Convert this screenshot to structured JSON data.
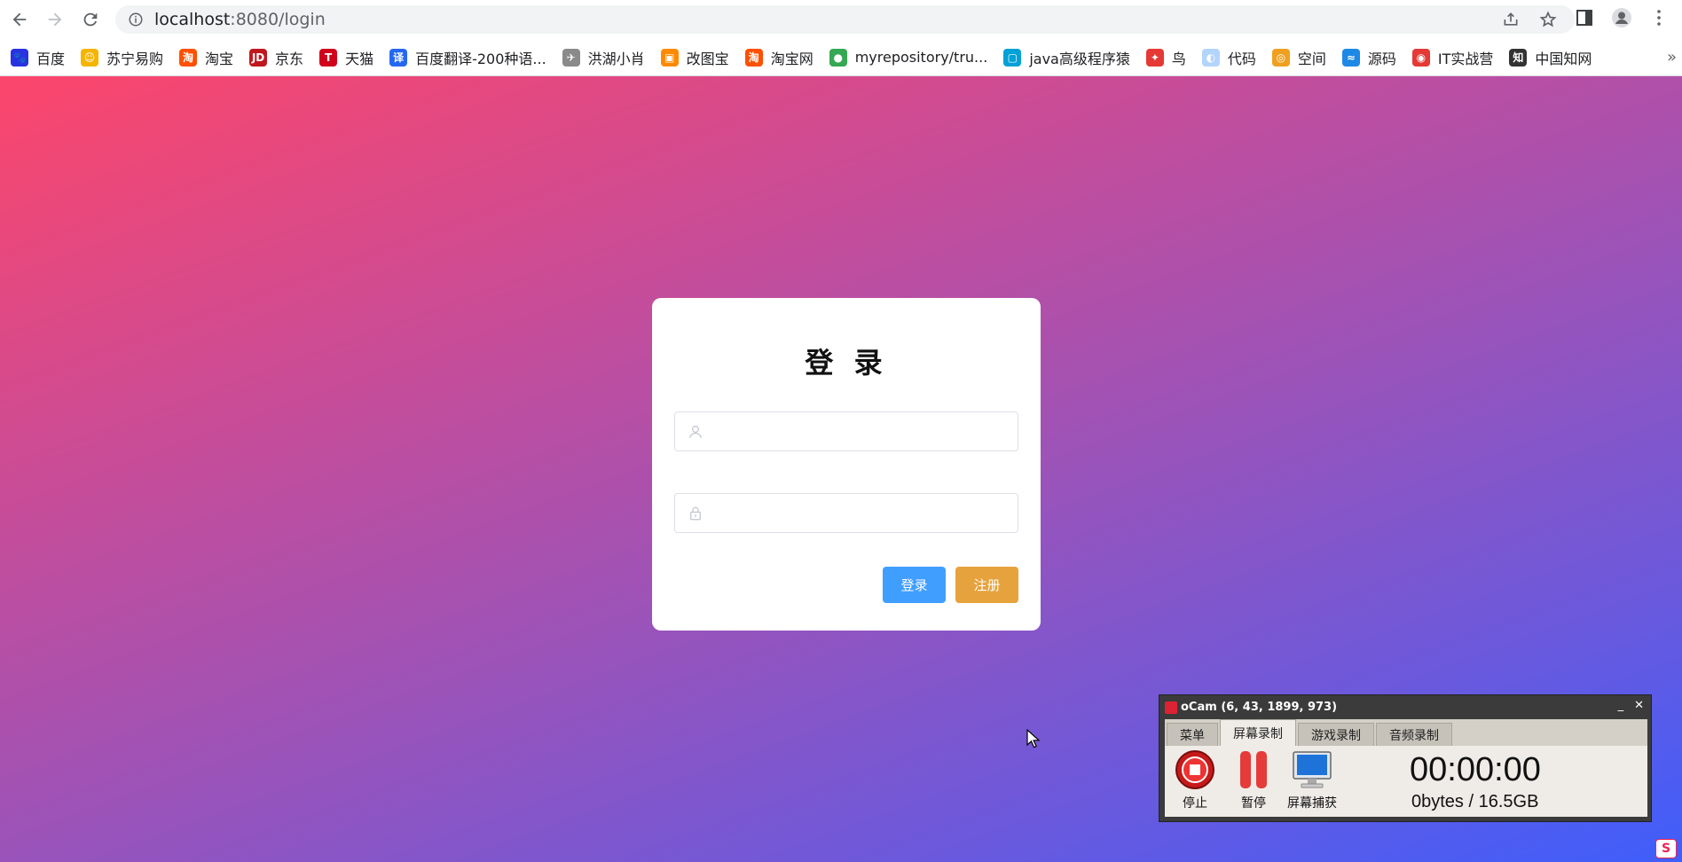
{
  "browser": {
    "url_host": "localhost",
    "url_path": ":8080/login"
  },
  "bookmarks": [
    {
      "label": "百度",
      "icon": "paw-icon",
      "color": "#2932e1",
      "glyph": "🐾"
    },
    {
      "label": "苏宁易购",
      "icon": "suning-icon",
      "color": "#f5b400",
      "glyph": "☺"
    },
    {
      "label": "淘宝",
      "icon": "taobao-icon",
      "color": "#ff5000",
      "glyph": "淘"
    },
    {
      "label": "京东",
      "icon": "jd-icon",
      "color": "#c0171e",
      "glyph": "JD"
    },
    {
      "label": "天猫",
      "icon": "tmall-icon",
      "color": "#d0021b",
      "glyph": "T"
    },
    {
      "label": "百度翻译-200种语...",
      "icon": "translate-icon",
      "color": "#2468f2",
      "glyph": "译"
    },
    {
      "label": "洪湖小肖",
      "icon": "bird-icon",
      "color": "#8a8a8a",
      "glyph": "✈"
    },
    {
      "label": "改图宝",
      "icon": "gaitubao-icon",
      "color": "#ff8a00",
      "glyph": "▣"
    },
    {
      "label": "淘宝网",
      "icon": "taobao-icon",
      "color": "#ff5000",
      "glyph": "淘"
    },
    {
      "label": "myrepository/tru...",
      "icon": "chrome-icon",
      "color": "#34a853",
      "glyph": "●"
    },
    {
      "label": "java高级程序猿",
      "icon": "bilibili-icon",
      "color": "#00a1d6",
      "glyph": "▢"
    },
    {
      "label": "鸟",
      "icon": "bird-icon",
      "color": "#e53935",
      "glyph": "✦"
    },
    {
      "label": "代码",
      "icon": "code-icon",
      "color": "#b3d4fc",
      "glyph": "◐"
    },
    {
      "label": "空间",
      "icon": "space-icon",
      "color": "#f0a020",
      "glyph": "◎"
    },
    {
      "label": "源码",
      "icon": "fish-icon",
      "color": "#1e88e5",
      "glyph": "≈"
    },
    {
      "label": "IT实战营",
      "icon": "it-icon",
      "color": "#e53935",
      "glyph": "◉"
    },
    {
      "label": "中国知网",
      "icon": "cnki-icon",
      "color": "#333333",
      "glyph": "知"
    }
  ],
  "login": {
    "title": "登 录",
    "username_placeholder": "",
    "password_placeholder": "",
    "login_button": "登录",
    "register_button": "注册"
  },
  "ocam": {
    "title": "oCam (6, 43, 1899, 973)",
    "tabs": [
      "菜单",
      "屏幕录制",
      "游戏录制",
      "音频录制"
    ],
    "active_tab": "屏幕录制",
    "stop_label": "停止",
    "pause_label": "暂停",
    "capture_label": "屏幕捕获",
    "timer": "00:00:00",
    "size": "0bytes / 16.5GB"
  },
  "colors": {
    "login_button": "#409eff",
    "register_button": "#e6a23c"
  }
}
